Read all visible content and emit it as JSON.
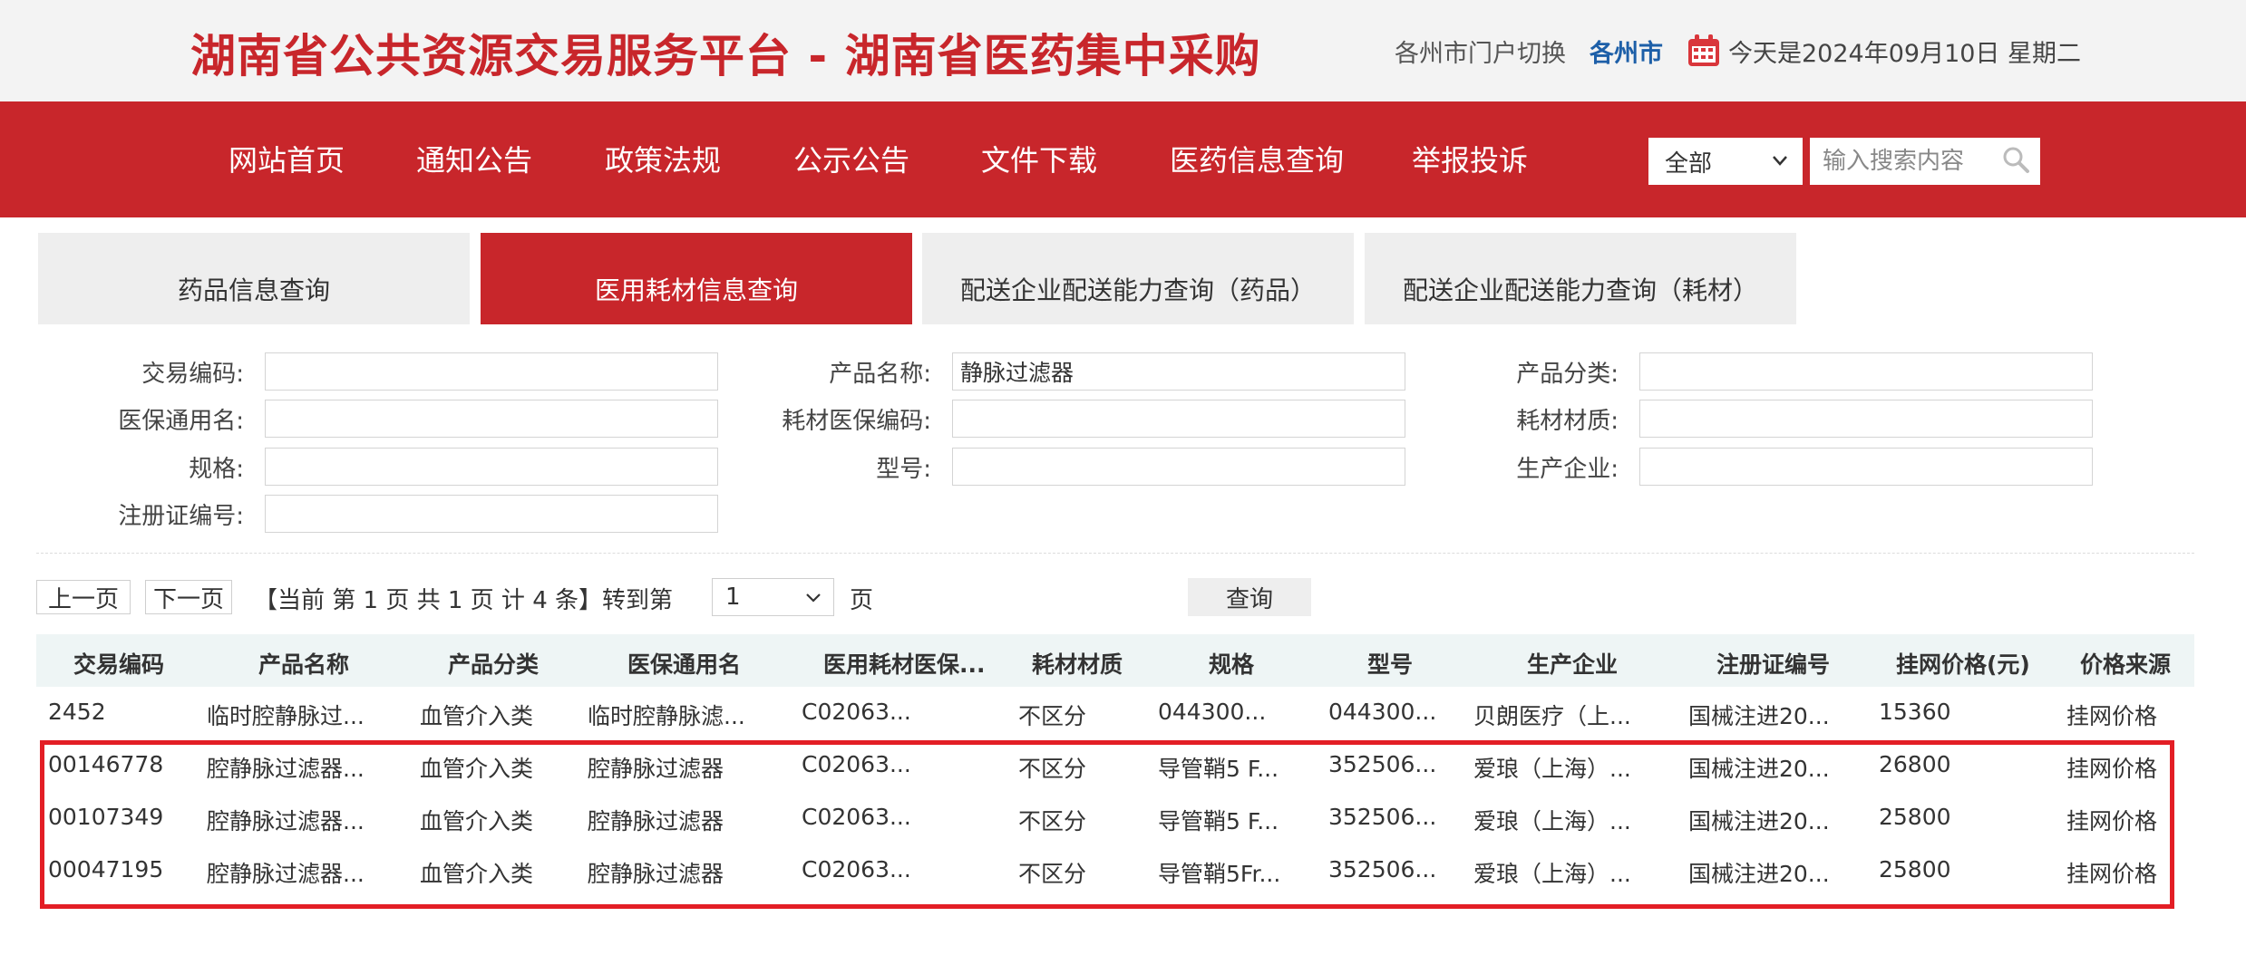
{
  "header": {
    "site_title": "湖南省公共资源交易服务平台 - 湖南省医药集中采购",
    "portal_switch": "各州市门户切换",
    "city": "各州市",
    "date_text": "今天是2024年09月10日 星期二"
  },
  "nav": {
    "items": [
      "网站首页",
      "通知公告",
      "政策法规",
      "公示公告",
      "文件下载",
      "医药信息查询",
      "举报投诉"
    ],
    "search_scope": "全部",
    "search_placeholder": "输入搜索内容"
  },
  "tabs": [
    {
      "label": "药品信息查询",
      "active": false
    },
    {
      "label": "医用耗材信息查询",
      "active": true
    },
    {
      "label": "配送企业配送能力查询（药品）",
      "active": false
    },
    {
      "label": "配送企业配送能力查询（耗材）",
      "active": false
    }
  ],
  "filters": {
    "trade_code_label": "交易编码:",
    "insurance_name_label": "医保通用名:",
    "spec_label": "规格:",
    "reg_no_label": "注册证编号:",
    "product_name_label": "产品名称:",
    "product_name_value": "静脉过滤器",
    "consumable_code_label": "耗材医保编码:",
    "model_label": "型号:",
    "category_label": "产品分类:",
    "material_label": "耗材材质:",
    "manufacturer_label": "生产企业:"
  },
  "pagination": {
    "prev": "上一页",
    "next": "下一页",
    "info": "【当前 第 1 页   共 1 页   计 4 条】转到第",
    "page_value": "1",
    "page_suffix": "页",
    "query": "查询"
  },
  "table": {
    "headers": [
      "交易编码",
      "产品名称",
      "产品分类",
      "医保通用名",
      "医用耗材医保...",
      "耗材材质",
      "规格",
      "型号",
      "生产企业",
      "注册证编号",
      "挂网价格(元)",
      "价格来源"
    ],
    "rows": [
      [
        "2452",
        "临时腔静脉过...",
        "血管介入类",
        "临时腔静脉滤...",
        "C02063...",
        "不区分",
        "044300...",
        "044300...",
        "贝朗医疗（上...",
        "国械注进20...",
        "15360",
        "挂网价格"
      ],
      [
        "00146778",
        "腔静脉过滤器...",
        "血管介入类",
        "腔静脉过滤器",
        "C02063...",
        "不区分",
        "导管鞘5 F...",
        "352506...",
        "爱琅（上海）...",
        "国械注进20...",
        "26800",
        "挂网价格"
      ],
      [
        "00107349",
        "腔静脉过滤器...",
        "血管介入类",
        "腔静脉过滤器",
        "C02063...",
        "不区分",
        "导管鞘5 F...",
        "352506...",
        "爱琅（上海）...",
        "国械注进20...",
        "25800",
        "挂网价格"
      ],
      [
        "00047195",
        "腔静脉过滤器...",
        "血管介入类",
        "腔静脉过滤器",
        "C02063...",
        "不区分",
        "导管鞘5Fr...",
        "352506...",
        "爱琅（上海）...",
        "国械注进20...",
        "25800",
        "挂网价格"
      ]
    ]
  },
  "colors": {
    "brand_red": "#c8262b",
    "highlight_red": "#e31e25",
    "city_blue": "#1d5fa8"
  }
}
